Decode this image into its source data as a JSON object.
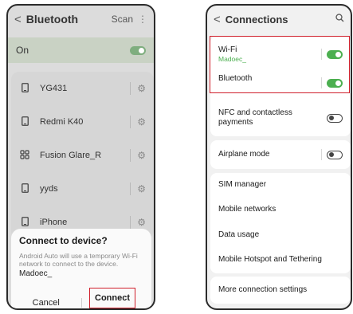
{
  "left_phone": {
    "header": {
      "back": "<",
      "title": "Bluetooth",
      "scan": "Scan",
      "more": "⋮"
    },
    "on_row": {
      "label": "On"
    },
    "devices": [
      {
        "name": "YG431",
        "icon": "phone-icon"
      },
      {
        "name": "Redmi K40",
        "icon": "phone-icon"
      },
      {
        "name": "Fusion Glare_R",
        "icon": "grid-icon"
      },
      {
        "name": "yyds",
        "icon": "phone-icon"
      },
      {
        "name": "iPhone",
        "icon": "phone-icon"
      }
    ],
    "dialog": {
      "title": "Connect to device?",
      "message": "Android Auto will use a temporary Wi-Fi network to connect to the device.",
      "network": "Madoec_",
      "cancel_label": "Cancel",
      "connect_label": "Connect"
    }
  },
  "right_phone": {
    "header": {
      "back": "<",
      "title": "Connections"
    },
    "wifi": {
      "label": "Wi-Fi",
      "network": "Madoec_"
    },
    "bluetooth": {
      "label": "Bluetooth"
    },
    "nfc": {
      "label": "NFC and contactless payments"
    },
    "airplane": {
      "label": "Airplane mode"
    },
    "menu": [
      {
        "label": "SIM manager"
      },
      {
        "label": "Mobile networks"
      },
      {
        "label": "Data usage"
      },
      {
        "label": "Mobile Hotspot and Tethering"
      }
    ],
    "more": {
      "label": "More connection settings"
    }
  },
  "colors": {
    "accent_green": "#4caf50",
    "highlight_red": "#d0202c"
  }
}
